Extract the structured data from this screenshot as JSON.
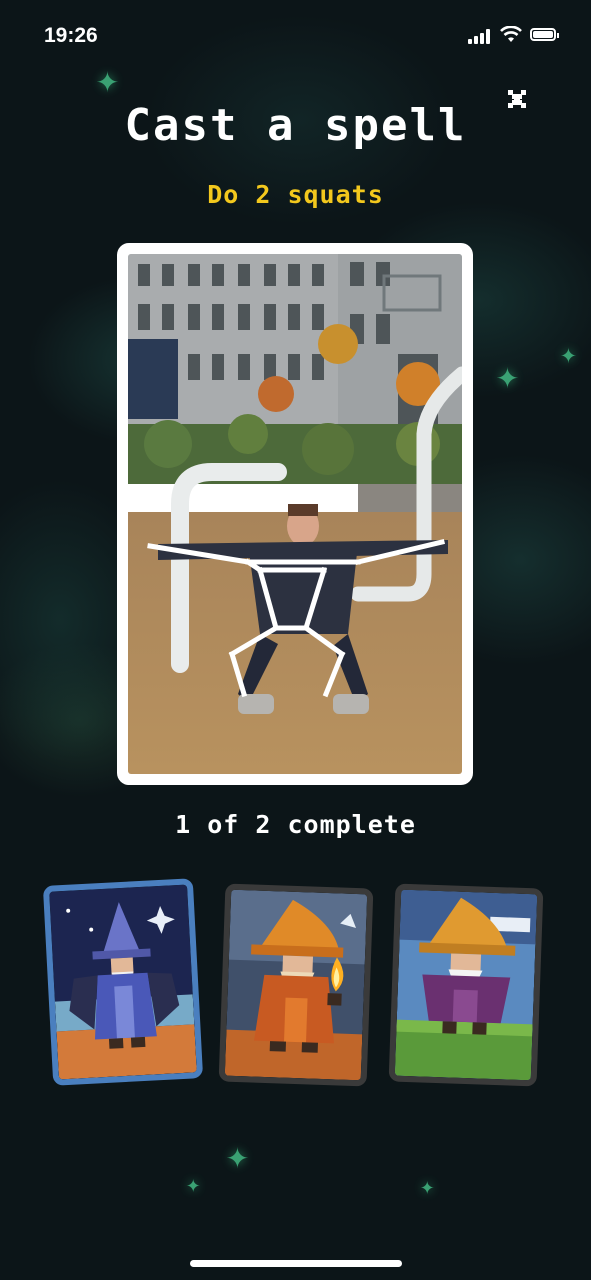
{
  "status_bar": {
    "time": "19:26"
  },
  "header": {
    "title": "Cast a spell",
    "subtitle": "Do 2 squats"
  },
  "progress": {
    "text": "1 of 2 complete",
    "completed": 1,
    "total": 2
  },
  "cards": [
    {
      "name": "Blue wizard",
      "selected": true,
      "border_color": "#4a7fbf"
    },
    {
      "name": "Fire wizard",
      "selected": false,
      "border_color": "#3a3a3a"
    },
    {
      "name": "Purple wizard",
      "selected": false,
      "border_color": "#3a3a3a"
    }
  ],
  "icons": {
    "close": "close-icon",
    "signal": "signal-icon",
    "wifi": "wifi-icon",
    "battery": "battery-icon"
  },
  "colors": {
    "background": "#0c1518",
    "title": "#ffffff",
    "subtitle": "#f3c81d",
    "sparkle": "#46c48a",
    "selected_card_border": "#4a7fbf"
  }
}
